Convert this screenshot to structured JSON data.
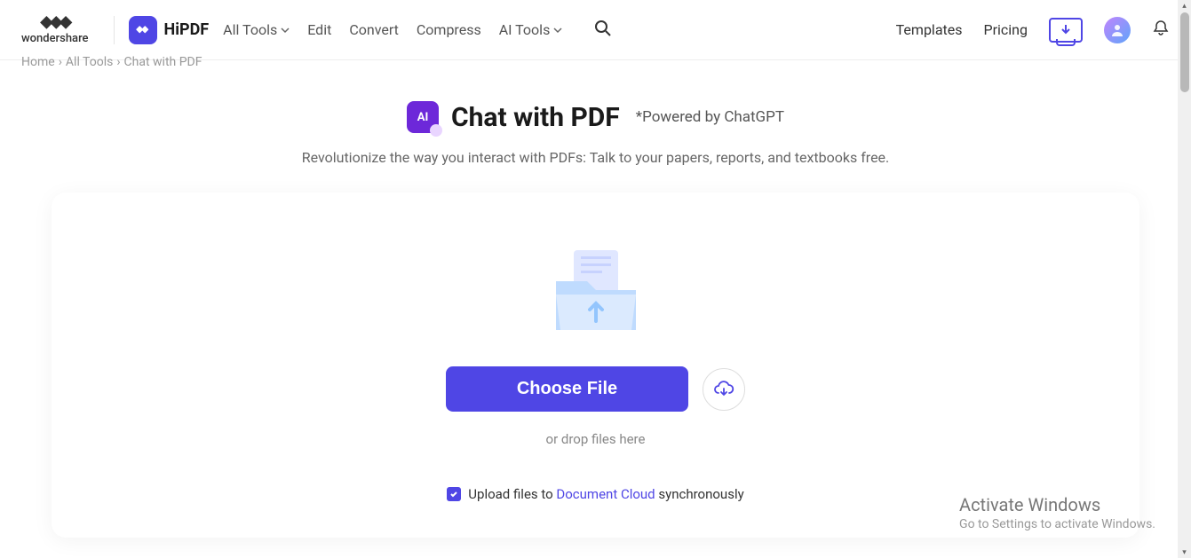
{
  "brand": {
    "name": "wondershare"
  },
  "product": {
    "name": "HiPDF"
  },
  "nav": {
    "all_tools": "All Tools",
    "edit": "Edit",
    "convert": "Convert",
    "compress": "Compress",
    "ai_tools": "AI Tools"
  },
  "right_nav": {
    "templates": "Templates",
    "pricing": "Pricing"
  },
  "breadcrumb": {
    "home": "Home",
    "sep": "›",
    "all_tools": "All Tools",
    "current": "Chat with PDF"
  },
  "hero": {
    "badge": "AI",
    "title": "Chat with PDF",
    "subtitle": "*Powered by ChatGPT",
    "description": "Revolutionize the way you interact with PDFs: Talk to your papers, reports, and textbooks free."
  },
  "upload": {
    "choose_label": "Choose File",
    "drop_text": "or drop files here",
    "sync_prefix": "Upload files to ",
    "sync_link": "Document Cloud",
    "sync_suffix": " synchronously"
  },
  "activate": {
    "title": "Activate Windows",
    "subtitle": "Go to Settings to activate Windows."
  }
}
